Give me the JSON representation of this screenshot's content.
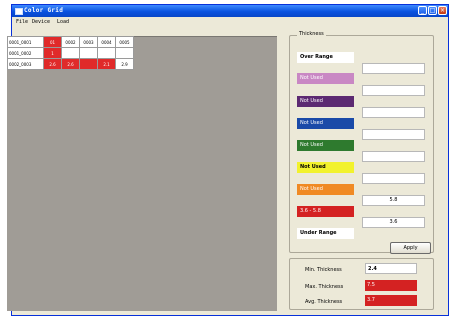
{
  "window": {
    "title": "Color Grid"
  },
  "menu": [
    "File",
    "Device",
    "Load"
  ],
  "grid": {
    "header": [
      "0001_0001",
      "01",
      "0002",
      "0003",
      "0004",
      "0005"
    ],
    "rows": [
      {
        "label": "0001_0002",
        "cells": [
          "1",
          "",
          "",
          "",
          ""
        ]
      },
      {
        "label": "0002_0003",
        "cells": [
          "2.6",
          "2.6",
          "",
          "2.1",
          "2.9"
        ]
      }
    ]
  },
  "thickness": {
    "group_label": "Thickness",
    "over_range": "Over Range",
    "bands": [
      {
        "label": "Not Used",
        "color": "#c988c4",
        "text_color": "#ffffff"
      },
      {
        "label": "Not Used",
        "color": "#5c2a72",
        "text_color": "#ffffff"
      },
      {
        "label": "Not Used",
        "color": "#1a4aa8",
        "text_color": "#ffffff"
      },
      {
        "label": "Not Used",
        "color": "#2e7a2e",
        "text_color": "#ffffff"
      },
      {
        "label": "Not Used",
        "color": "#f2f22c",
        "text_color": "#000000"
      },
      {
        "label": "Not Used",
        "color": "#f08a24",
        "text_color": "#ffffff"
      },
      {
        "label": "3.6 - 5.8",
        "color": "#d42222",
        "text_color": "#ffffff"
      }
    ],
    "under_range": "Under Range",
    "threshold_values": [
      "",
      "",
      "",
      "",
      "",
      "",
      "",
      "5.8",
      "3.6"
    ],
    "apply_label": "Apply"
  },
  "stats": [
    {
      "label": "Min. Thickness",
      "value": "2.4",
      "bg": "#ffffff",
      "fg": "#000000"
    },
    {
      "label": "Max. Thickness",
      "value": "7.5",
      "bg": "#d42222",
      "fg": "#ffffff"
    },
    {
      "label": "Avg. Thickness",
      "value": "3.7",
      "bg": "#d42222",
      "fg": "#ffffff"
    }
  ]
}
